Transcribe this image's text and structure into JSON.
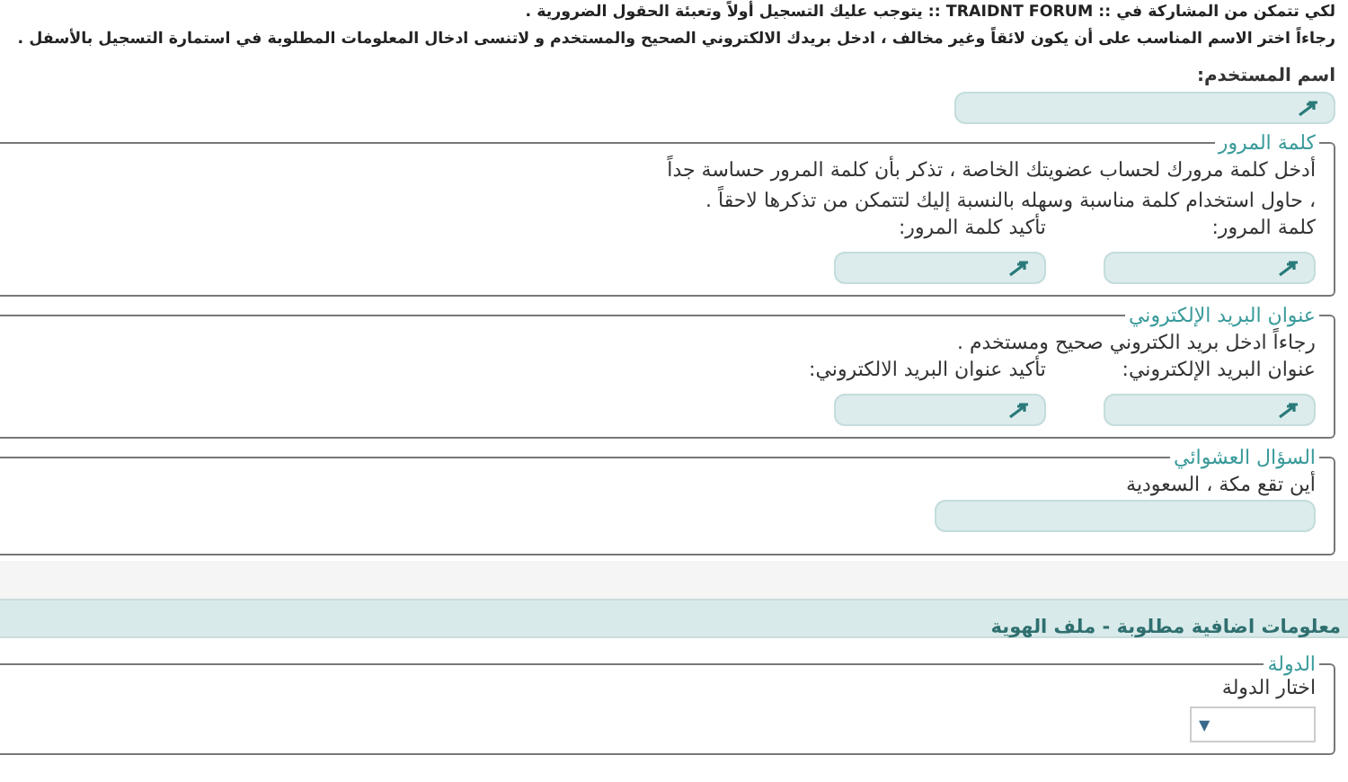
{
  "intro": [
    "لكي تتمكن من المشاركة في :: TRAIDNT FORUM :: يتوجب عليك التسجيل أولاً وتعبئة الحقول الضرورية .",
    "رجاءاً اختر الاسم المناسب على أن يكون لائقاً وغير مخالف ، ادخل بريدك الالكتروني الصحيح والمستخدم و لاتنسى ادخال المعلومات المطلوبة في استمارة التسجيل بالأسفل ."
  ],
  "username": {
    "label": "اسم المستخدم:",
    "icon": true
  },
  "sections": [
    {
      "kind": "fieldset",
      "legend": "كلمة المرور",
      "lines": [
        "أدخل كلمة مرورك لحساب عضويتك الخاصة ، تذكر بأن كلمة المرور حساسة جداً",
        "، حاول استخدام كلمة مناسبة وسهله بالنسبة إليك لتتمكن من تذكرها لاحقاً ."
      ],
      "fields": [
        {
          "kind": "text",
          "label": "كلمة المرور:",
          "icon": true
        },
        {
          "kind": "text",
          "label": "تأكيد كلمة المرور:",
          "icon": true
        }
      ]
    },
    {
      "kind": "fieldset",
      "legend": "عنوان البريد الإلكتروني",
      "lines": [
        "رجاءاً ادخل بريد الكتروني صحيح ومستخدم ."
      ],
      "fields": [
        {
          "kind": "text",
          "label": "عنوان البريد الإلكتروني:",
          "icon": true
        },
        {
          "kind": "text",
          "label": "تأكيد عنوان البريد الالكتروني:",
          "icon": true
        }
      ]
    },
    {
      "kind": "fieldset",
      "legend": "السؤال العشوائي",
      "lines": [
        "أين تقع مكة ، السعودية"
      ],
      "fields": [
        {
          "kind": "text",
          "icon": false
        }
      ]
    },
    {
      "kind": "banner",
      "title": "معلومات اضافية مطلوبة - ملف الهوية"
    },
    {
      "kind": "fieldset",
      "legend": "الدولة",
      "fields": [
        {
          "kind": "select",
          "label": "اختار الدولة",
          "arrow": "▼"
        }
      ]
    }
  ]
}
